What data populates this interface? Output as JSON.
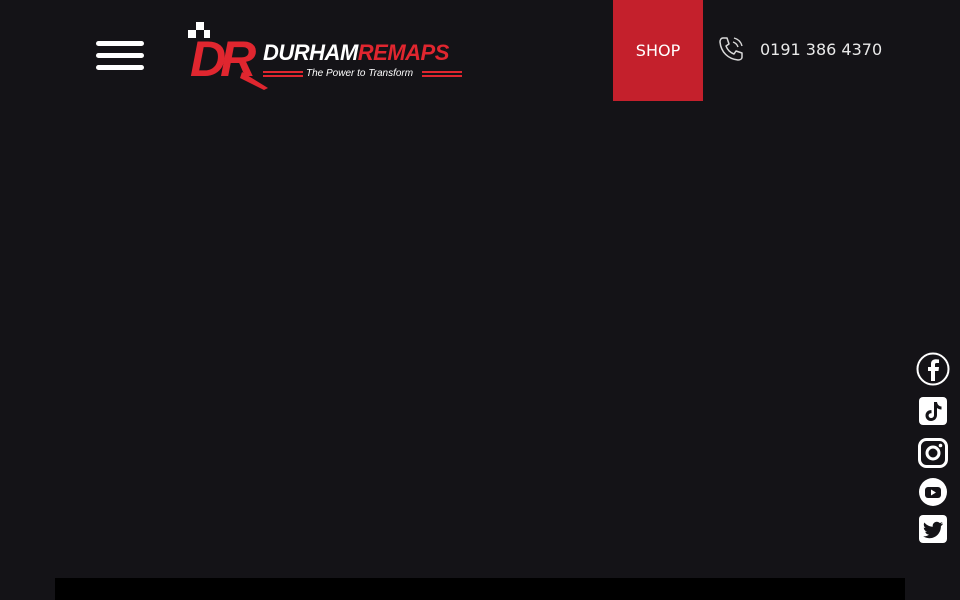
{
  "header": {
    "menu_icon": "hamburger-menu-icon",
    "logo": {
      "monogram": "DR",
      "brand_part1": "DURHAM",
      "brand_part2": "REMAPS",
      "tagline": "The Power to Transform"
    },
    "shop_label": "SHOP",
    "phone": {
      "icon": "phone-icon",
      "number": "0191 386 4370"
    }
  },
  "social": [
    {
      "name": "facebook",
      "icon": "facebook-icon"
    },
    {
      "name": "tiktok",
      "icon": "tiktok-icon"
    },
    {
      "name": "instagram",
      "icon": "instagram-icon"
    },
    {
      "name": "youtube",
      "icon": "youtube-icon"
    },
    {
      "name": "twitter",
      "icon": "twitter-icon"
    }
  ],
  "colors": {
    "background": "#141317",
    "accent": "#c4202c",
    "brand_red": "#e0262f",
    "text": "#ffffff"
  }
}
